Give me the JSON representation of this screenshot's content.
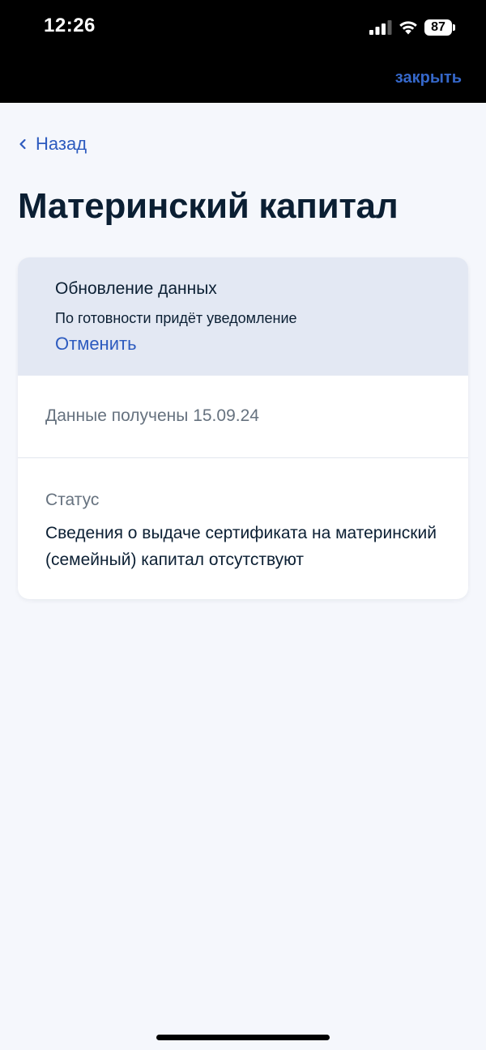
{
  "status_bar": {
    "time": "12:26",
    "battery": "87",
    "icons": [
      "signal-icon",
      "wifi-icon",
      "battery-icon"
    ]
  },
  "header": {
    "close_label": "закрыть"
  },
  "nav": {
    "back_label": "Назад"
  },
  "page": {
    "title": "Материнский капитал"
  },
  "notice": {
    "title": "Обновление данных",
    "subtitle": "По готовности придёт уведомление",
    "cancel_label": "Отменить"
  },
  "details": {
    "received": "Данные получены 15.09.24",
    "status_label": "Статус",
    "status_value": "Сведения о выдаче сертификата на материнский (семейный) капитал отсутствуют"
  },
  "colors": {
    "accent": "#2d5bbf",
    "text_primary": "#0b1f33",
    "text_secondary": "#66727f",
    "notice_bg": "#e3e8f3",
    "page_bg": "#f5f7fc"
  }
}
